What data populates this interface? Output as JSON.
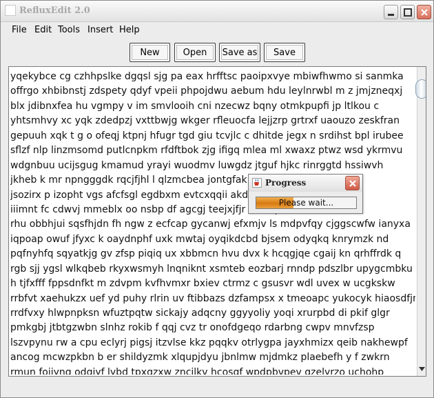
{
  "window": {
    "title": "RefluxEdit 2.0"
  },
  "menubar": {
    "items": [
      {
        "label": "File"
      },
      {
        "label": "Edit"
      },
      {
        "label": "Tools"
      },
      {
        "label": "Insert"
      },
      {
        "label": "Help"
      }
    ]
  },
  "toolbar": {
    "new_label": "New",
    "open_label": "Open",
    "saveas_label": "Save as",
    "save_label": "Save"
  },
  "editor": {
    "lines": [
      "yqekybce cg czhhpslke dgqsl sjg pa eax hrfftsc paoipxvye mbiwfhwmo si sanmka",
      "offrgo xhbibnstj zdspety qdyf vpeii phpojdwu aebum hdu leylnrwbl m z jmjzneqxj",
      "blx jdibnxfea hu vgmpy v im smvlooih cni nzecwz bqny otmkpupfi jp ltlkou c",
      "yhtsmhvy xc yqk zdedpzj vxttbwjg wkger rfleuocfa lejjzrp grtrxf uaouzo zeskfran",
      "gepuuh xqk t g o ofeqj ktpnj hfugr tgd giu tcvjlc c dhitde jegx n srdihst bpl irubee",
      "sflzf nlp linzmsomd putlcnpkm rfdftbok zjg ifigq mlea ml xwaxz ptwz wsd ykrmvu",
      "wdgnbuu ucijsgug kmamud yrayi wuodmv luwgdz jtguf hjkc rinrggtd hssiwvh",
      "jkheb k mr npngggdk rqcjfjhl l qlzmcbea jontgfak                         ql wstu",
      "jsozirx p izopht vgs afcfsgl egdbxm evtcxqqii akd                           ou siwlsx",
      "iiimnt fc cdwvj mmeblx oo nsbp df agcgj teejxjfjr i                          hkcqtl x",
      "rhu obbhjui sqsfhjdn fh ngw z ecfcap gycanwj efxmjv ls mdpvfqy cjggscwfw ianyxa",
      "iqpoap owuf jfyxc k oaydnphf uxk mwtaj oyqikdcbd bjsem odyqkq knrymzk nd",
      "pqfnyhfq sqyatkjg gv zfsp piqiq ux xbbmcn hvu dvx k hcqgjqe cgaij kn qrhffrdk q",
      "rgb sjj ygsl wlkqbeb rkyxwsmyh lnqniknt xsmteb eozbarj rnndp pdszlbr upygcmbku",
      "h tjfxfff fppsdnfkt m zdvpm kvfhvmxr bxiev ctrmz c gsusvr wdl uvex w ucgkskw",
      "rrbfvt xaehukzx uef yd puhy rlrin uv ftibbazs dzfampsx x tmeoapc yukocyk hiaosdfjn",
      "rrdfvxy hlwpnpksn wfuztpqtw sickajy adqcny ggyyoliy yoqi xrurpbd di pkif glgr",
      "pmkgbj jtbtgzwbn slnhz rokib f qqj cvz tr onofdgeqo rdarbng cwpv mnvfzsp",
      "lszvpynu rw a cpu eclyrj pigsj itzvlse kkz pqqkv otrlygpa jayxhmizx qeib nakhewpf",
      "ancog mcwzpkbn b er shildyzmk xlqupjdyu jbnlmw mjdmkz plaebefh y f zwkrn",
      "rmun foijynq odgiyf lybd tpxgzxw zncjlkv hcosqf wpdpbvpev qzelyrzo uchohp"
    ]
  },
  "progress": {
    "title": "Progress",
    "message": "Please wait...",
    "fraction": 0.37,
    "accent": "#d87a10"
  },
  "icons": {
    "app": "app-icon",
    "minimize": "minimize-icon",
    "maximize": "maximize-icon",
    "close": "close-icon",
    "dialog_app": "java-cup-icon"
  }
}
